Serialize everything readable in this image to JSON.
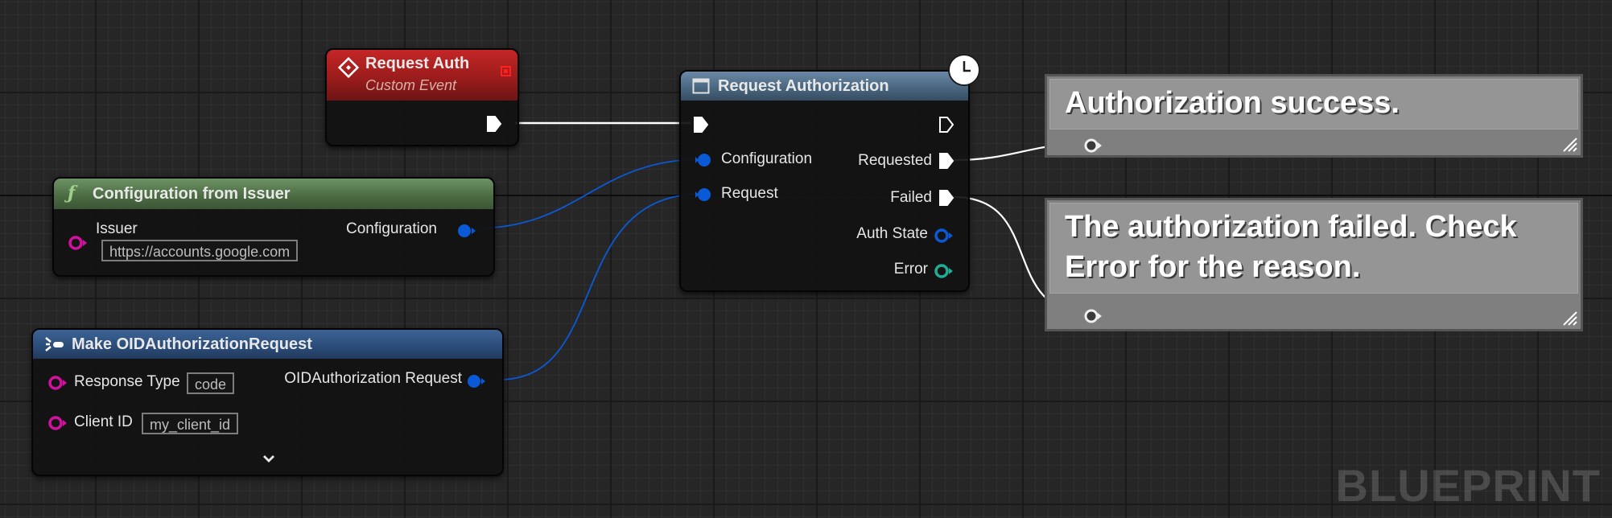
{
  "nodes": {
    "request_auth": {
      "title": "Request Auth",
      "subtitle": "Custom Event",
      "icon": "event-diamond-icon",
      "color": "#a01c1c"
    },
    "configuration_from_issuer": {
      "title": "Configuration from Issuer",
      "icon": "function-icon",
      "color": "#5a7b4f",
      "inputs": {
        "issuer_label": "Issuer",
        "issuer_value": "https://accounts.google.com"
      },
      "outputs": {
        "configuration_label": "Configuration"
      }
    },
    "make_request": {
      "title": "Make OIDAuthorizationRequest",
      "icon": "make-struct-icon",
      "color": "#2c4f7c",
      "inputs": {
        "response_type_label": "Response Type",
        "response_type_value": "code",
        "client_id_label": "Client ID",
        "client_id_value": "my_client_id"
      },
      "outputs": {
        "request_label": "OIDAuthorization Request"
      },
      "expand_icon": "chevron-down-icon"
    },
    "request_authorization": {
      "title": "Request Authorization",
      "icon": "window-icon",
      "latent_icon": "clock-icon",
      "color": "#4f6b85",
      "inputs": {
        "configuration_label": "Configuration",
        "request_label": "Request"
      },
      "outputs": {
        "requested_label": "Requested",
        "failed_label": "Failed",
        "auth_state_label": "Auth State",
        "error_label": "Error"
      }
    }
  },
  "comments": {
    "success": "Authorization success.",
    "failed": "The authorization failed. Check Error for the reason."
  },
  "watermark": "BLUEPRINT",
  "colors": {
    "exec": "#ffffff",
    "struct_pin": "#0a5ad8",
    "string_pin": "#d4109e",
    "error_pin": "#1fae94",
    "background": "#262626"
  }
}
